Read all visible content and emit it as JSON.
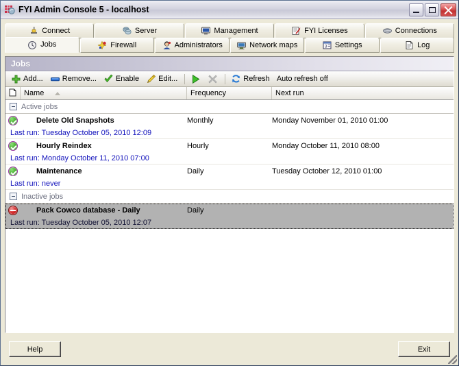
{
  "window": {
    "title": "FYI Admin Console 5 - localhost",
    "icon": "app-squares-icon",
    "controls": {
      "minimize": "minimize-button",
      "maximize": "maximize-button",
      "close": "close-button"
    }
  },
  "tabs_row1": [
    {
      "label": "Connect",
      "icon": "connect-icon",
      "active": false
    },
    {
      "label": "Server",
      "icon": "server-icon",
      "active": false
    },
    {
      "label": "Management",
      "icon": "management-icon",
      "active": false
    },
    {
      "label": "FYI Licenses",
      "icon": "license-icon",
      "active": false
    },
    {
      "label": "Connections",
      "icon": "connections-icon",
      "active": false
    }
  ],
  "tabs_row2": [
    {
      "label": "Jobs",
      "icon": "clock-icon",
      "active": true
    },
    {
      "label": "Firewall",
      "icon": "firewall-icon",
      "active": false
    },
    {
      "label": "Administrators",
      "icon": "administrator-icon",
      "active": false
    },
    {
      "label": "Network maps",
      "icon": "network-map-icon",
      "active": false
    },
    {
      "label": "Settings",
      "icon": "settings-icon",
      "active": false
    },
    {
      "label": "Log",
      "icon": "log-icon",
      "active": false
    }
  ],
  "panel": {
    "header": "Jobs"
  },
  "toolbar": {
    "add": "Add...",
    "remove": "Remove...",
    "enable": "Enable",
    "edit": "Edit...",
    "run": "run-button",
    "stop": "stop-button",
    "refresh": "Refresh",
    "auto_refresh_status": "Auto refresh off"
  },
  "columns": {
    "icon": "",
    "name": "Name",
    "frequency": "Frequency",
    "next_run": "Next run",
    "sorted_by": "Name",
    "sort_direction": "ascending"
  },
  "groups": [
    {
      "title": "Active jobs",
      "collapsed": false,
      "jobs": [
        {
          "status": "enabled",
          "name": "Delete Old Snapshots",
          "frequency": "Monthly",
          "next_run": "Monday November 01, 2010 01:00",
          "last_run": "Last run: Tuesday October 05, 2010 12:09",
          "selected": false
        },
        {
          "status": "enabled",
          "name": "Hourly Reindex",
          "frequency": "Hourly",
          "next_run": "Monday October 11, 2010 08:00",
          "last_run": "Last run: Monday October 11, 2010 07:00",
          "selected": false
        },
        {
          "status": "enabled",
          "name": "Maintenance",
          "frequency": "Daily",
          "next_run": "Tuesday October 12, 2010 01:00",
          "last_run": "Last run: never",
          "selected": false
        }
      ]
    },
    {
      "title": "Inactive jobs",
      "collapsed": false,
      "jobs": [
        {
          "status": "disabled",
          "name": "Pack Cowco database - Daily",
          "frequency": "Daily",
          "next_run": "",
          "last_run": "Last run: Tuesday October 05, 2010 12:07",
          "selected": true
        }
      ]
    }
  ],
  "footer": {
    "help": "Help",
    "exit": "Exit"
  },
  "colors": {
    "title_bar_start": "#f2f2f6",
    "title_bar_end": "#eeeef4",
    "close_button": "#c23232",
    "panel_header_start": "#b6b4c8",
    "panel_header_end": "#f0eff5",
    "last_run_text": "#1111bb",
    "group_label_text": "#6d7080",
    "selected_row": "#b2b2b2",
    "status_enabled": "#4cb534",
    "status_disabled": "#d93030",
    "window_face": "#ece9d8"
  }
}
